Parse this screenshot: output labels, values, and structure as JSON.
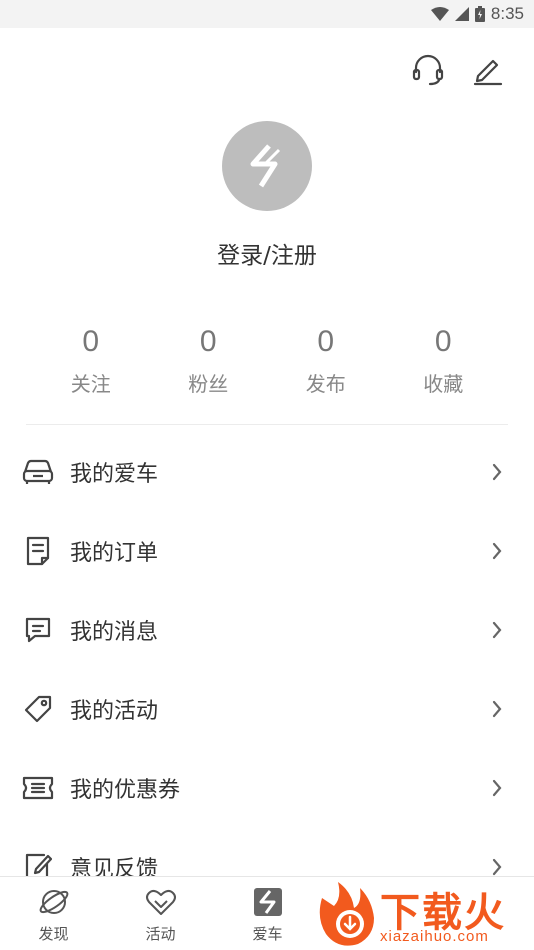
{
  "status_bar": {
    "time": "8:35"
  },
  "header": {
    "icons": [
      "headset-icon",
      "edit-icon"
    ]
  },
  "profile": {
    "login_label": "登录/注册"
  },
  "stats": [
    {
      "value": "0",
      "label": "关注"
    },
    {
      "value": "0",
      "label": "粉丝"
    },
    {
      "value": "0",
      "label": "发布"
    },
    {
      "value": "0",
      "label": "收藏"
    }
  ],
  "menu": [
    {
      "label": "我的爱车",
      "icon": "car-icon"
    },
    {
      "label": "我的订单",
      "icon": "order-icon"
    },
    {
      "label": "我的消息",
      "icon": "message-icon"
    },
    {
      "label": "我的活动",
      "icon": "tag-icon"
    },
    {
      "label": "我的优惠券",
      "icon": "coupon-icon"
    },
    {
      "label": "意见反馈",
      "icon": "feedback-icon"
    }
  ],
  "tabbar": [
    {
      "label": "发现",
      "icon": "planet-icon"
    },
    {
      "label": "活动",
      "icon": "heart-icon"
    },
    {
      "label": "爱车",
      "icon": "brand-logo-icon"
    }
  ],
  "watermark": {
    "title": "下载火",
    "url": "xiazaihuo.com"
  },
  "colors": {
    "accent": "#f25a1e",
    "avatar_bg": "#bdbdbd",
    "text": "#333333"
  }
}
